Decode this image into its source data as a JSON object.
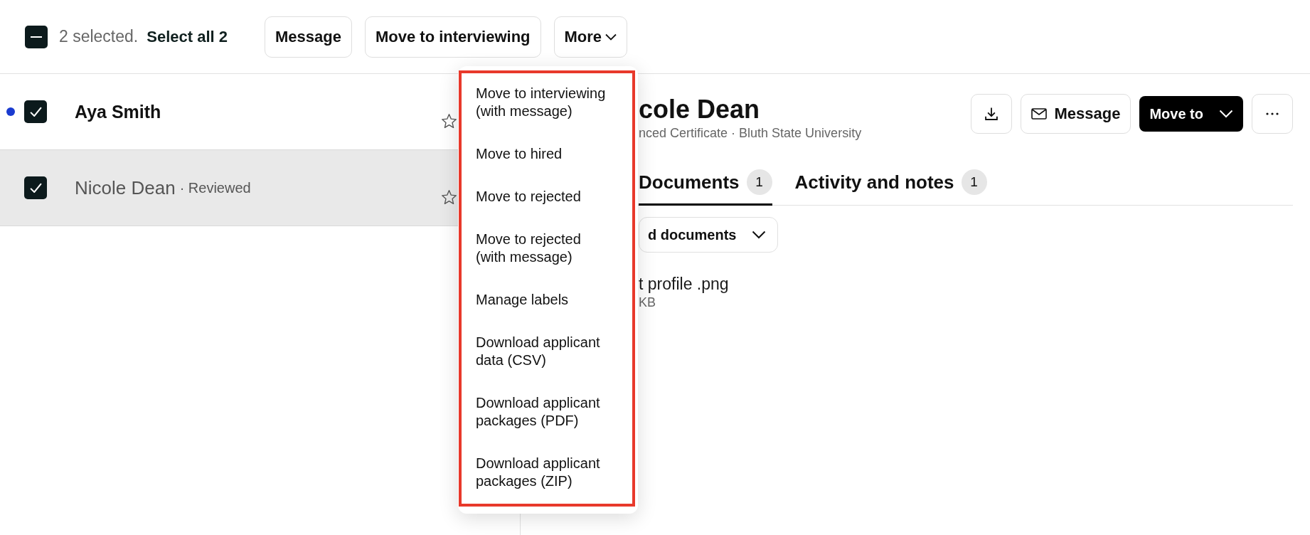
{
  "bulk_bar": {
    "checkbox": {
      "indeterminate": true
    },
    "count": "2 selected.",
    "select_all": "Select all 2",
    "buttons": [
      {
        "label": "Message",
        "kind": "plain"
      },
      {
        "label": "Move to interviewing",
        "kind": "plain"
      },
      {
        "label": "More",
        "kind": "dropdown"
      }
    ]
  },
  "applicants": [
    {
      "name": "Aya Smith",
      "unread": true,
      "checked": true,
      "selected": false,
      "starred": false
    },
    {
      "name": "Nicole Dean",
      "status": "· Reviewed",
      "unread": false,
      "checked": true,
      "selected": true,
      "starred": false
    }
  ],
  "menu": {
    "highlighted": true,
    "items": [
      "Move to interviewing (with message)",
      "Move to hired",
      "Move to rejected",
      "Move to rejected (with message)",
      "Manage labels",
      "Download applicant data (CSV)",
      "Download applicant packages (PDF)",
      "Download applicant packages (ZIP)"
    ]
  },
  "detail": {
    "title": "cole Dean",
    "subtitle": "nced Certificate · Bluth State University",
    "message_button": "Message",
    "move_button": "Move to",
    "tabs": [
      {
        "label": "Documents",
        "count": "1",
        "selected": true
      },
      {
        "label": "Activity and notes",
        "count": "1",
        "selected": false
      }
    ],
    "filter": "d documents",
    "files": [
      {
        "name": "t profile .png",
        "size": "KB"
      }
    ]
  }
}
